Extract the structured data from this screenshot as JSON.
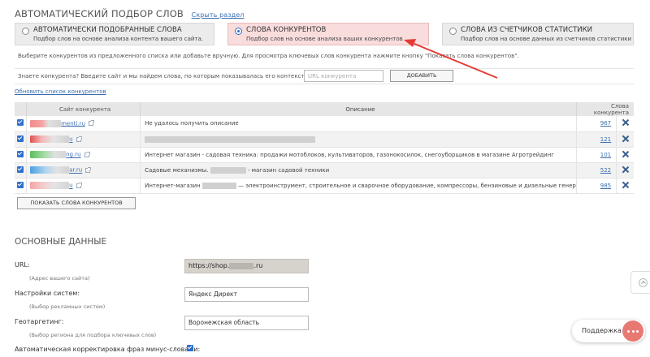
{
  "section": {
    "title": "АВТОМАТИЧЕСКИЙ ПОДБОР СЛОВ",
    "hide_link": "Скрыть раздел"
  },
  "options": [
    {
      "title": "АВТОМАТИЧЕСКИ ПОДОБРАННЫЕ СЛОВА",
      "subtitle": "Подбор слов на основе анализа контента вашего сайта.",
      "selected": false
    },
    {
      "title": "СЛОВА КОНКУРЕНТОВ",
      "subtitle": "Подбор слов на основе анализа ваших конкурентов",
      "selected": true
    },
    {
      "title": "СЛОВА ИЗ СЧЕТЧИКОВ СТАТИСТИКИ",
      "subtitle": "Подбор слов на основе данных из счетчиков статистики",
      "selected": false
    }
  ],
  "info_text": "Выберите конкурентов из предложенного списка или добавьте вручную. Для просмотра ключевых слов конкурента нажмите кнопку \"Показать слова конкурентов\".",
  "add_competitor": {
    "label": "Знаете конкурента? Введите сайт и мы найдем слова, по которым показывалась его контекстная реклама:",
    "placeholder": "URL конкурента",
    "button": "ДОБАВИТЬ"
  },
  "refresh_link": "Обновить список конкурентов",
  "table": {
    "headers": {
      "site": "Сайт конкурента",
      "description": "Описание",
      "count": "Слова конкурента"
    },
    "rows": [
      {
        "site": "menti.ru",
        "description": "Не удалось получить описание",
        "count": "967",
        "checked": true
      },
      {
        "site": "u",
        "description": "",
        "count": "121",
        "checked": true
      },
      {
        "site": "ng.ru",
        "description": "Интернет магазин - садовая техника: продажи мотоблоков, культиваторов, газонокосилок, снегоуборщиков в магазине Агротрейдинг",
        "count": "101",
        "checked": true
      },
      {
        "site": "ar.ru",
        "description": "Садовые механизмы.",
        "description2": "- магазин садовой техники",
        "count": "522",
        "checked": true
      },
      {
        "site": "u",
        "description": "Интернет-магазин",
        "description2": "— электроинструмент, строительное и сварочное оборудование, компрессоры, бензиновые и дизельные генер",
        "count": "985",
        "checked": true
      }
    ]
  },
  "show_button": "ПОКАЗАТЬ СЛОВА КОНКУРЕНТОВ",
  "basic": {
    "title": "ОСНОВНЫЕ ДАННЫЕ",
    "url_label": "URL:",
    "url_sub": "(Адрес вашего сайта)",
    "url_value_prefix": "https://shop.",
    "url_value_suffix": ".ru",
    "systems_label": "Настройки систем:",
    "systems_sub": "(Выбор рекламных систем)",
    "systems_value": "Яндекс Директ",
    "geo_label": "Геотаргетинг:",
    "geo_sub": "(Выбор региона для подбора ключевых слов)",
    "geo_value": "Воронежская область",
    "auto_label": "Автоматическая корректировка фраз минус-словами:",
    "auto_checked": true
  },
  "support_label": "Поддержка",
  "colors": {
    "accent": "#3b6fb0",
    "checkbox": "#2f6fd0",
    "active_option": "#f9dcdc",
    "arrow": "#e53935",
    "support": "#e87872"
  }
}
